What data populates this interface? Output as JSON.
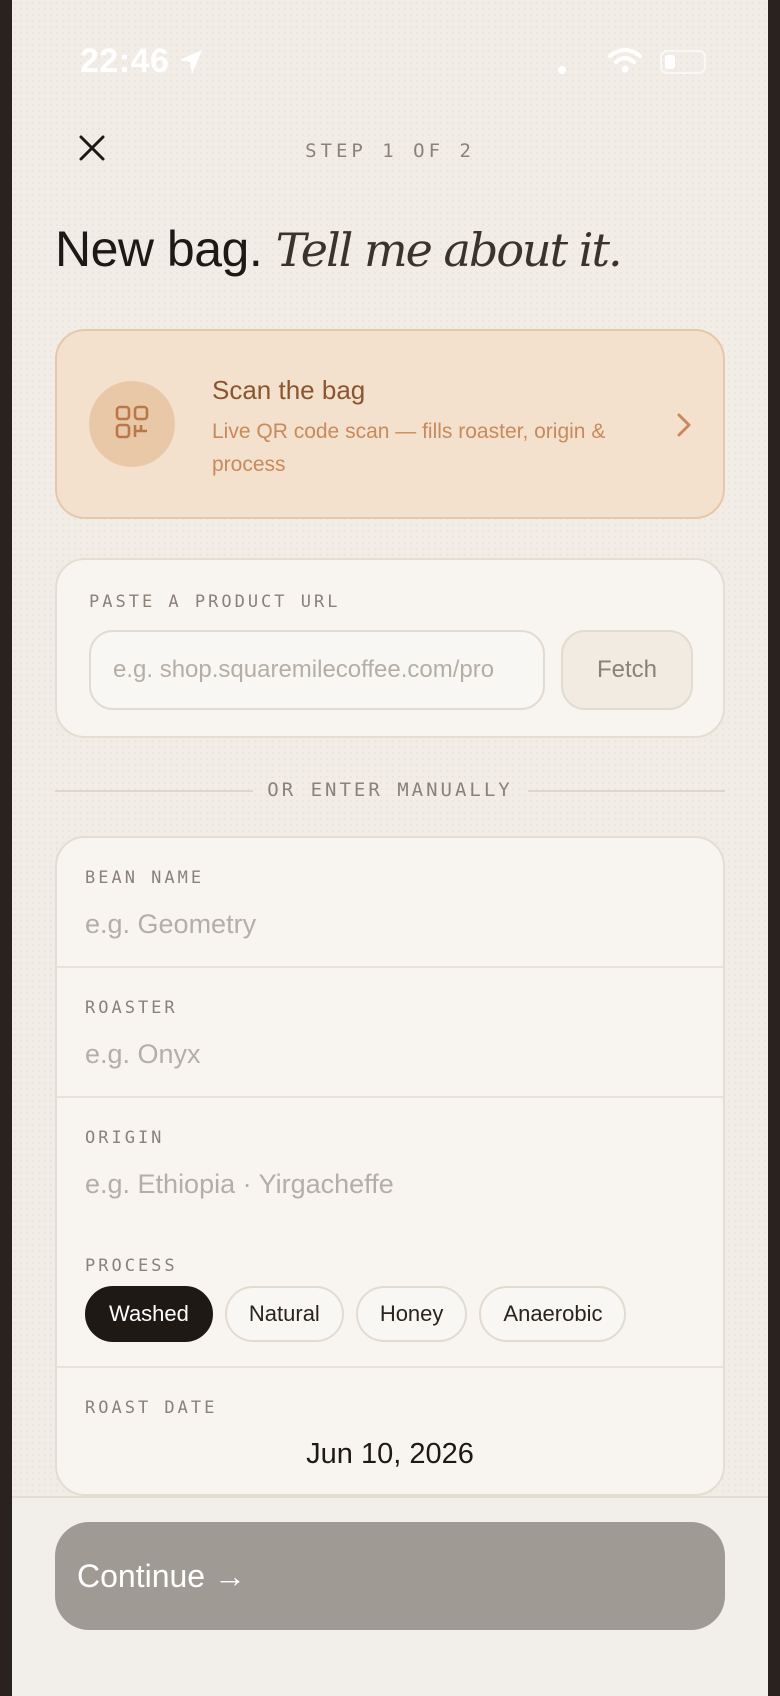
{
  "status_bar": {
    "time": "22:46"
  },
  "header": {
    "step": "STEP 1 OF 2",
    "title_plain": "New bag.",
    "title_italic": "Tell me about it."
  },
  "scan_card": {
    "title": "Scan the bag",
    "subtitle": "Live QR code scan — fills roaster, origin & process",
    "icon": "qr-scan-icon"
  },
  "url_card": {
    "label": "PASTE A PRODUCT URL",
    "placeholder": "e.g. shop.squaremilecoffee.com/pro",
    "button": "Fetch"
  },
  "divider": {
    "text": "OR ENTER MANUALLY"
  },
  "form": {
    "bean_name": {
      "label": "BEAN NAME",
      "placeholder": "e.g. Geometry"
    },
    "roaster": {
      "label": "ROASTER",
      "placeholder": "e.g. Onyx"
    },
    "origin": {
      "label": "ORIGIN",
      "placeholder": "e.g. Ethiopia · Yirgacheffe"
    },
    "process": {
      "label": "PROCESS",
      "options": [
        "Washed",
        "Natural",
        "Honey",
        "Anaerobic"
      ],
      "selected": "Washed"
    },
    "roast_date": {
      "label": "ROAST DATE",
      "value": "Jun 10, 2026"
    }
  },
  "footer": {
    "continue": "Continue →"
  },
  "colors": {
    "accent_peach": "#f4e1cd",
    "accent_brown": "#8a5530",
    "button_disabled": "#a09a95",
    "chip_active": "#1e1915"
  }
}
